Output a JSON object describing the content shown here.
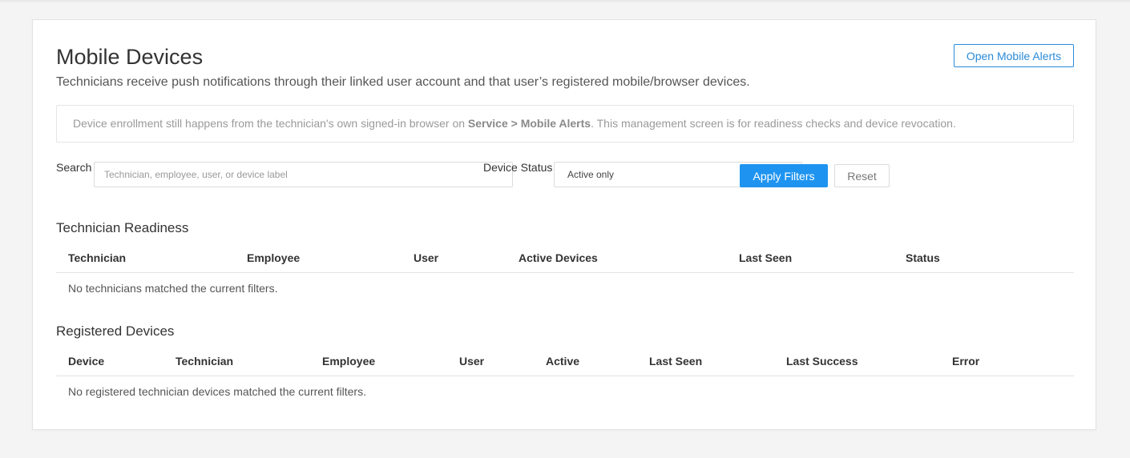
{
  "header": {
    "title": "Mobile Devices",
    "subtitle": "Technicians receive push notifications through their linked user account and that user’s registered mobile/browser devices.",
    "open_alerts_label": "Open Mobile Alerts"
  },
  "notice": {
    "before": "Device enrollment still happens from the technician's own signed-in browser on ",
    "emphasis": "Service > Mobile Alerts",
    "after": ". This management screen is for readiness checks and device revocation."
  },
  "filters": {
    "search_label": "Search",
    "search_placeholder": "Technician, employee, user, or device label",
    "search_value": "",
    "status_label": "Device Status",
    "status_value": "Active only",
    "apply_label": "Apply Filters",
    "reset_label": "Reset"
  },
  "readiness": {
    "title": "Technician Readiness",
    "columns": [
      "Technician",
      "Employee",
      "User",
      "Active Devices",
      "Last Seen",
      "Status"
    ],
    "empty_message": "No technicians matched the current filters."
  },
  "devices": {
    "title": "Registered Devices",
    "columns": [
      "Device",
      "Technician",
      "Employee",
      "User",
      "Active",
      "Last Seen",
      "Last Success",
      "Error"
    ],
    "empty_message": "No registered technician devices matched the current filters."
  },
  "colors": {
    "accent": "#1e94f0",
    "accent_outline": "#2a8bd8",
    "background": "#f4f4f4"
  }
}
